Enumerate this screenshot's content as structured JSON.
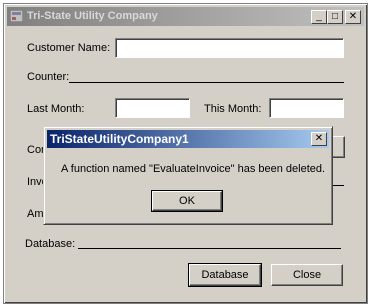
{
  "window": {
    "title": "Tri-State Utility Company",
    "minimize": "_",
    "maximize": "□",
    "close": "✕"
  },
  "form": {
    "customer_name_label": "Customer Name:",
    "customer_name_value": "",
    "counter_label": "Counter:",
    "last_month_label": "Last Month:",
    "last_month_value": "",
    "this_month_label": "This Month:",
    "this_month_value": "",
    "partial_label_1": "Con",
    "partial_label_2": "Invo",
    "partial_label_3": "Amo",
    "database_label": "Database:",
    "database_button": "Database",
    "close_button": "Close"
  },
  "dialog": {
    "title": "TriStateUtilityCompany1",
    "close": "✕",
    "message": "A function named \"EvaluateInvoice\" has been deleted.",
    "ok": "OK"
  }
}
